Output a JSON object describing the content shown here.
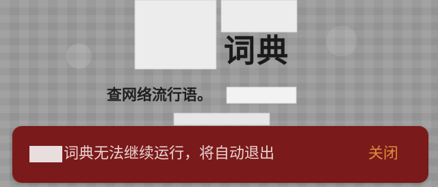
{
  "splash": {
    "app_title": "词典",
    "tagline": "查网络流行语。"
  },
  "toast": {
    "message": "词典无法继续运行，将自动退出",
    "close_label": "关闭",
    "colors": {
      "background": "#7a1a1b",
      "message_text": "#e9d3d0",
      "close_text": "#e08a3c"
    }
  }
}
